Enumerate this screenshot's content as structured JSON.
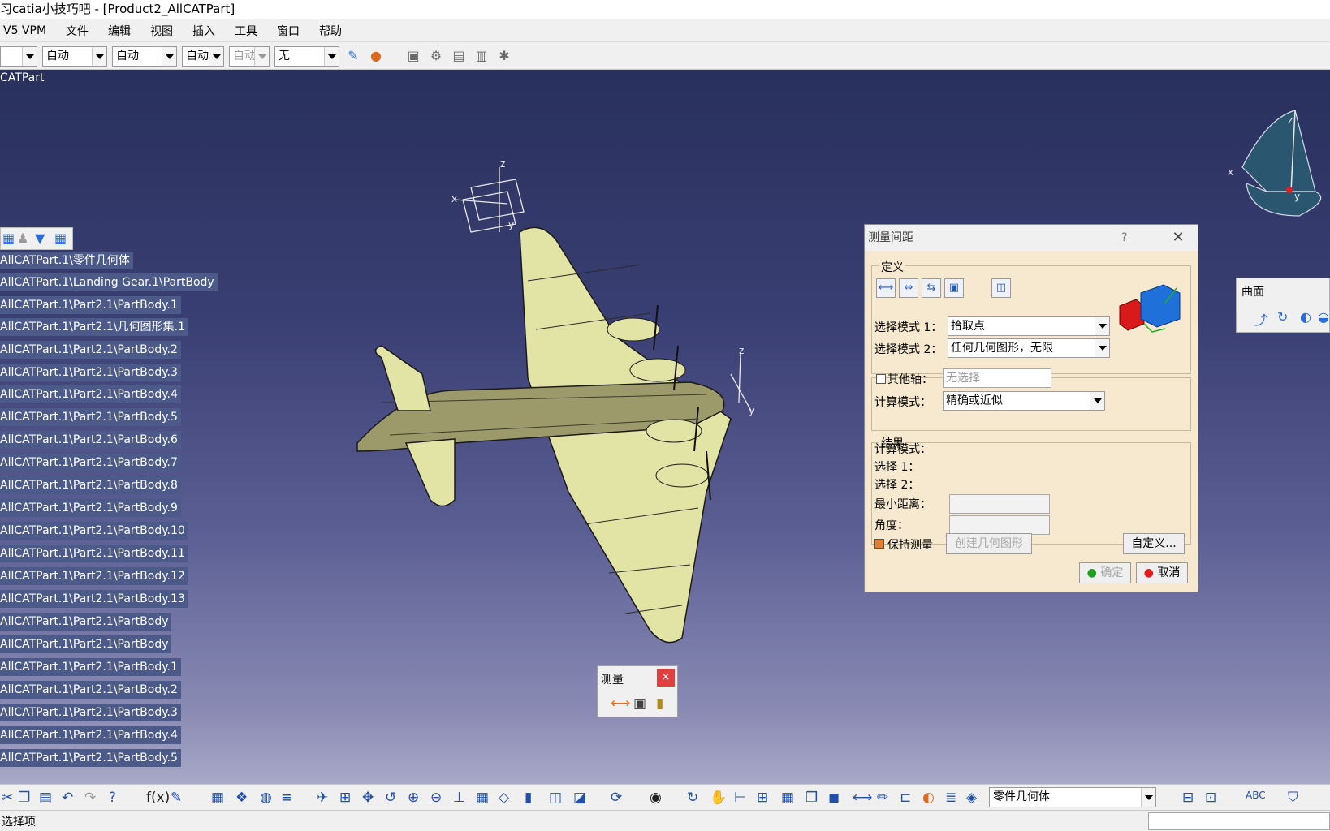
{
  "window": {
    "title": "习catia小技巧吧 - [Product2_AllCATPart]"
  },
  "menu": [
    "V5 VPM",
    "文件",
    "编辑",
    "视图",
    "插入",
    "工具",
    "窗口",
    "帮助"
  ],
  "toolbar_top": {
    "combos": [
      "",
      "自动",
      "自动",
      "自动",
      "自动",
      "无"
    ],
    "icons": [
      "brush-icon",
      "paint-icon",
      "properties-icon",
      "gear-icon",
      "copy-icon",
      "paste-icon",
      "settings-icon"
    ]
  },
  "viewport": {
    "doc_label": "CATPart",
    "tree_toolbar_icons": [
      "grid-icon",
      "users-icon",
      "shirt-icon",
      "apps-icon"
    ],
    "tree_items": [
      "AllCATPart.1\\零件几何体",
      "AllCATPart.1\\Landing Gear.1\\PartBody",
      "AllCATPart.1\\Part2.1\\PartBody.1",
      "AllCATPart.1\\Part2.1\\几何图形集.1",
      "AllCATPart.1\\Part2.1\\PartBody.2",
      "AllCATPart.1\\Part2.1\\PartBody.3",
      "AllCATPart.1\\Part2.1\\PartBody.4",
      "AllCATPart.1\\Part2.1\\PartBody.5",
      "AllCATPart.1\\Part2.1\\PartBody.6",
      "AllCATPart.1\\Part2.1\\PartBody.7",
      "AllCATPart.1\\Part2.1\\PartBody.8",
      "AllCATPart.1\\Part2.1\\PartBody.9",
      "AllCATPart.1\\Part2.1\\PartBody.10",
      "AllCATPart.1\\Part2.1\\PartBody.11",
      "AllCATPart.1\\Part2.1\\PartBody.12",
      "AllCATPart.1\\Part2.1\\PartBody.13",
      "AllCATPart.1\\Part2.1\\PartBody",
      "AllCATPart.1\\Part2.1\\PartBody",
      "AllCATPart.1\\Part2.1\\PartBody.1",
      "AllCATPart.1\\Part2.1\\PartBody.2",
      "AllCATPart.1\\Part2.1\\PartBody.3",
      "AllCATPart.1\\Part2.1\\PartBody.4",
      "AllCATPart.1\\Part2.1\\PartBody.5"
    ],
    "axis_labels": {
      "x": "x",
      "y": "y",
      "z": "z"
    },
    "compass_labels": {
      "x": "x",
      "y": "y",
      "z": "z"
    }
  },
  "measure_toolbar": {
    "title": "测量",
    "close": "×"
  },
  "surface_toolbar": {
    "title": "曲面"
  },
  "dialog": {
    "title": "测量间距",
    "help": "?",
    "close": "✕",
    "definition_label": "定义",
    "mode1_label": "选择模式 1：",
    "mode1_value": "拾取点",
    "mode2_label": "选择模式 2：",
    "mode2_value": "任何几何图形，无限",
    "other_axis_label": "其他轴：",
    "other_axis_placeholder": "无选择",
    "calc_mode_label": "计算模式：",
    "calc_mode_value": "精确或近似",
    "results_label": "结果",
    "r_calc_mode": "计算模式：",
    "r_sel1": "选择 1：",
    "r_sel2": "选择 2：",
    "r_min_dist": "最小距离：",
    "r_angle": "角度：",
    "keep_measure": "保持测量",
    "create_geometry": "创建几何图形",
    "customize": "自定义...",
    "ok": "确定",
    "cancel": "取消"
  },
  "bottom_toolbar": {
    "current_body": "零件几何体"
  },
  "status": {
    "text": "选择项"
  }
}
